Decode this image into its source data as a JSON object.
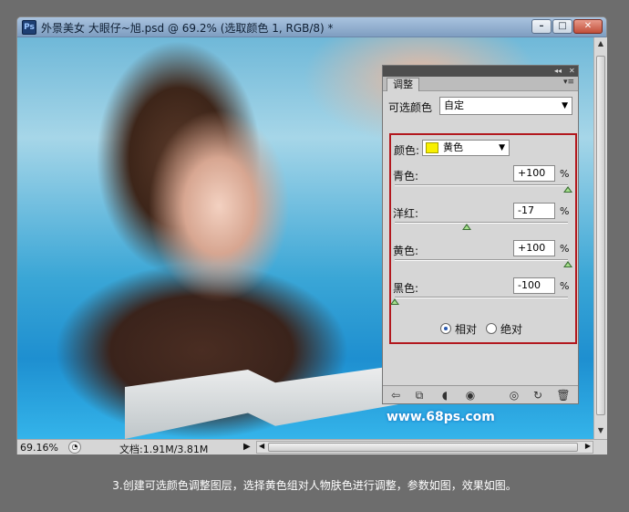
{
  "window": {
    "title": "外景美女 大眼仔~旭.psd @ 69.2% (选取颜色 1, RGB/8) *",
    "app_icon": "Ps",
    "buttons": {
      "minimize": "minimize-icon",
      "maximize": "maximize-icon",
      "close": "close-icon"
    }
  },
  "canvas": {
    "watermark": "www.68ps.com"
  },
  "status": {
    "zoom": "69.16%",
    "doc_info": "文档:1.91M/3.81M"
  },
  "panel": {
    "tab": "调整",
    "preset_label": "可选颜色",
    "preset_value": "自定",
    "color_label": "颜色:",
    "color_value": "黄色",
    "color_swatch": "#f8f000",
    "sliders": [
      {
        "label": "青色:",
        "value": "+100",
        "unit": "%",
        "level": 1.0
      },
      {
        "label": "洋红:",
        "value": "-17",
        "unit": "%",
        "level": 0.415
      },
      {
        "label": "黄色:",
        "value": "+100",
        "unit": "%",
        "level": 1.0
      },
      {
        "label": "黑色:",
        "value": "-100",
        "unit": "%",
        "level": 0.0
      }
    ],
    "method": {
      "relative": "相对",
      "absolute": "绝对",
      "selected": "relative"
    }
  },
  "caption": "3.创建可选颜色调整图层，选择黄色组对人物肤色进行调整，参数如图，效果如图。",
  "colors": {
    "highlight_box": "#b2181e",
    "title_bar": "#8fb0d3"
  }
}
